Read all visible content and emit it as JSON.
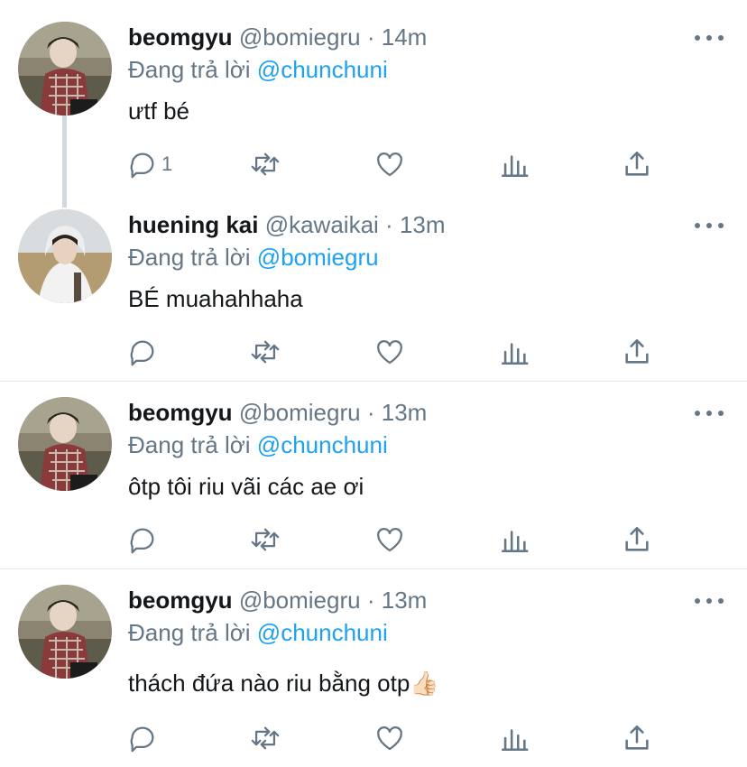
{
  "tweets": [
    {
      "display_name": "beomgyu",
      "handle": "@bomiegru",
      "separator": "·",
      "time": "14m",
      "reply_prefix": "Đang trả lời",
      "reply_to": "@chunchuni",
      "text": "ưtf bé",
      "reply_count": "1",
      "avatar": "beomgyu-avatar"
    },
    {
      "display_name": "huening kai",
      "handle": "@kawaikai",
      "separator": "·",
      "time": "13m",
      "reply_prefix": "Đang trả lời",
      "reply_to": "@bomiegru",
      "text": "BÉ muahahhaha",
      "reply_count": "",
      "avatar": "hueningkai-avatar"
    },
    {
      "display_name": "beomgyu",
      "handle": "@bomiegru",
      "separator": "·",
      "time": "13m",
      "reply_prefix": "Đang trả lời",
      "reply_to": "@chunchuni",
      "text": "ôtp tôi riu vãi các ae ơi",
      "reply_count": "",
      "avatar": "beomgyu-avatar"
    },
    {
      "display_name": "beomgyu",
      "handle": "@bomiegru",
      "separator": "·",
      "time": "13m",
      "reply_prefix": "Đang trả lời",
      "reply_to": "@chunchuni",
      "text": "thách đứa nào riu bằng otp👍🏻",
      "reply_count": "",
      "avatar": "beomgyu-avatar"
    }
  ],
  "icons": {
    "reply": "reply-icon",
    "retweet": "retweet-icon",
    "like": "like-icon",
    "analytics": "analytics-icon",
    "share": "share-icon",
    "more": "more-icon"
  },
  "colors": {
    "mention": "#1da1f2",
    "secondary_text": "#657786",
    "icon": "#657786",
    "divider": "#e1e8ed"
  }
}
